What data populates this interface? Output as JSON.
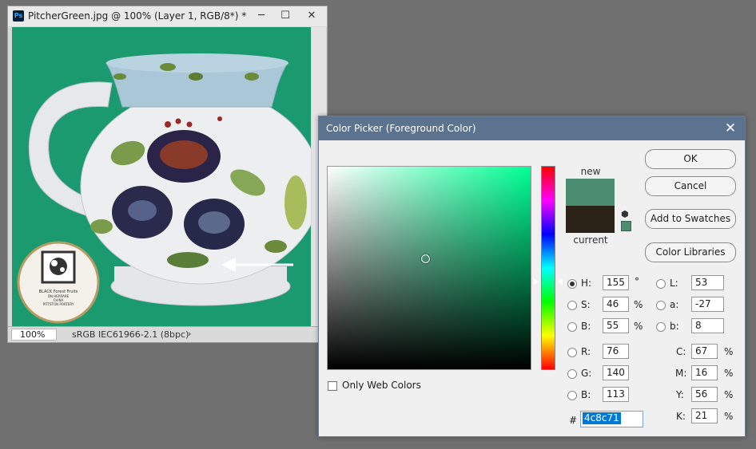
{
  "document_window": {
    "app_icon_label": "Ps",
    "title": "PitcherGreen.jpg @ 100% (Layer 1, RGB/8*) *",
    "minimize_glyph": "─",
    "maximize_glyph": "☐",
    "close_glyph": "✕",
    "status": {
      "zoom": "100%",
      "profile": "sRGB IEC61966-2.1 (8bpc)",
      "menu_arrow": "›"
    },
    "canvas_background_color": "#1b9a6f",
    "stamp_text": [
      "BLACK Forest Fruits",
      "ON HERRARE",
      "CHINA",
      "PITTSTON PORTERY"
    ]
  },
  "color_picker": {
    "title": "Color Picker (Foreground Color)",
    "close_glyph": "✕",
    "new_label": "new",
    "current_label": "current",
    "new_color": "#4c8c71",
    "current_color": "#2b2317",
    "buttons": {
      "ok": "OK",
      "cancel": "Cancel",
      "add_to_swatches": "Add to Swatches",
      "color_libraries": "Color Libraries"
    },
    "hsb": [
      {
        "label": "H:",
        "value": "155",
        "unit": "°",
        "selected": true
      },
      {
        "label": "S:",
        "value": "46",
        "unit": "%",
        "selected": false
      },
      {
        "label": "B:",
        "value": "55",
        "unit": "%",
        "selected": false
      }
    ],
    "rgb": [
      {
        "label": "R:",
        "value": "76"
      },
      {
        "label": "G:",
        "value": "140"
      },
      {
        "label": "B:",
        "value": "113"
      }
    ],
    "lab": [
      {
        "label": "L:",
        "value": "53"
      },
      {
        "label": "a:",
        "value": "-27"
      },
      {
        "label": "b:",
        "value": "8"
      }
    ],
    "cmyk": [
      {
        "label": "C:",
        "value": "67",
        "unit": "%"
      },
      {
        "label": "M:",
        "value": "16",
        "unit": "%"
      },
      {
        "label": "Y:",
        "value": "56",
        "unit": "%"
      },
      {
        "label": "K:",
        "value": "21",
        "unit": "%"
      }
    ],
    "only_web_colors_label": "Only Web Colors",
    "only_web_colors_checked": false,
    "hex_prefix": "#",
    "hex_value": "4c8c71",
    "field_hue_color": "#00ff94"
  }
}
